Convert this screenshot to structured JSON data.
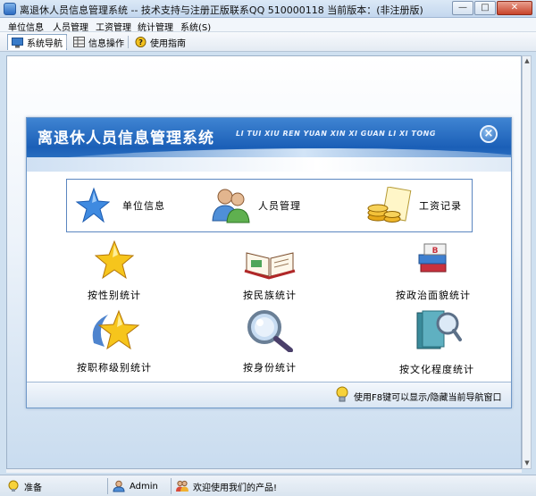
{
  "window": {
    "title": "离退休人员信息管理系统 -- 技术支持与注册正版联系QQ 510000118   当前版本：(非注册版)"
  },
  "menu": [
    "单位信息",
    "人员管理",
    "工资管理",
    "统计管理",
    "系统(S)"
  ],
  "toolbar": {
    "nav_label": "系统导航",
    "info_label": "信息操作",
    "help_label": "使用指南"
  },
  "panel": {
    "title": "离退休人员信息管理系统",
    "pinyin": "LI TUI XIU REN YUAN XIN XI GUAN LI XI TONG",
    "main_items": [
      "单位信息",
      "人员管理",
      "工资记录"
    ],
    "stat_items": [
      "按性别统计",
      "按民族统计",
      "按政治面貌统计",
      "按职称级别统计",
      "按身份统计",
      "按文化程度统计"
    ],
    "footer_hint": "使用F8键可以显示/隐藏当前导航窗口"
  },
  "status": {
    "state": "准备",
    "user": "Admin",
    "welcome": "欢迎使用我们的产品!"
  }
}
